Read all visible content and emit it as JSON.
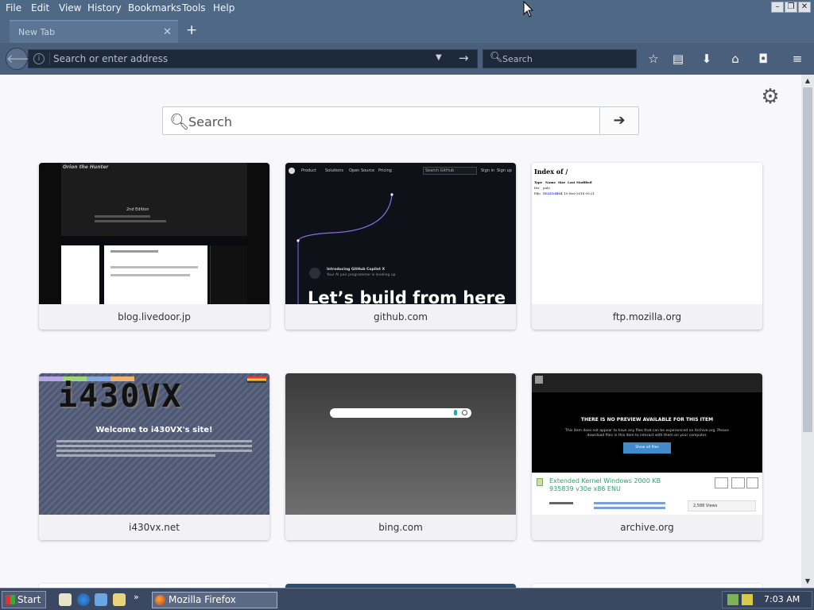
{
  "menubar": {
    "items": [
      "File",
      "Edit",
      "View",
      "History",
      "Bookmarks",
      "Tools",
      "Help"
    ]
  },
  "tabs": {
    "active": {
      "label": "New Tab"
    }
  },
  "navbar": {
    "url_placeholder": "Search or enter address",
    "search_placeholder": "Search"
  },
  "content": {
    "search_placeholder": "Search"
  },
  "tiles": [
    {
      "title": "blog.livedoor.jp"
    },
    {
      "title": "github.com"
    },
    {
      "title": "ftp.mozilla.org"
    },
    {
      "title": "i430vx.net"
    },
    {
      "title": "bing.com"
    },
    {
      "title": "archive.org"
    }
  ],
  "thumb_text": {
    "livedoor_header": "Orion the Hunter",
    "livedoor_edition": "2nd Edition",
    "github_nav": [
      "Product",
      "Solutions",
      "Open Source",
      "Pricing"
    ],
    "github_search": "Search GitHub",
    "github_signin": "Sign in",
    "github_signup": "Sign up",
    "github_copilot_title": "Introducing GitHub Copilot X",
    "github_copilot_sub": "Your AI pair programmer is leveling up",
    "github_headline": "Let’s build from here",
    "ftp_title": "Index of /",
    "ftp_cols": [
      "Type",
      "Name",
      "Size",
      "Last Modified"
    ],
    "ftp_rows": [
      [
        "Dir",
        "pub/",
        "",
        ""
      ],
      [
        "File",
        "README",
        "384",
        "15-Nov-2018 09:21"
      ]
    ],
    "i430_logo": "i430VX",
    "i430_welcome": "Welcome to i430VX's site!",
    "archive_notice": "THERE IS NO PREVIEW AVAILABLE FOR THIS ITEM",
    "archive_notice_sub": "This item does not appear to have any files that can be experienced on Archive.org. Please download files in this item to interact with them on your computer.",
    "archive_show_all": "Show all files",
    "archive_item_title": "Extended Kernel Windows 2000 KB 935839 v30e x86 ENU",
    "archive_views": "2,588 Views"
  },
  "taskbar": {
    "start_label": "Start",
    "task_label": "Mozilla Firefox",
    "clock": "7:03 AM"
  },
  "colors": {
    "chrome": "#4f6886",
    "navbar": "#4a5f7c",
    "urlbar": "#1d2a3b",
    "content_bg": "#f8f8fa",
    "tile_title_bg": "#f2f2f4"
  }
}
